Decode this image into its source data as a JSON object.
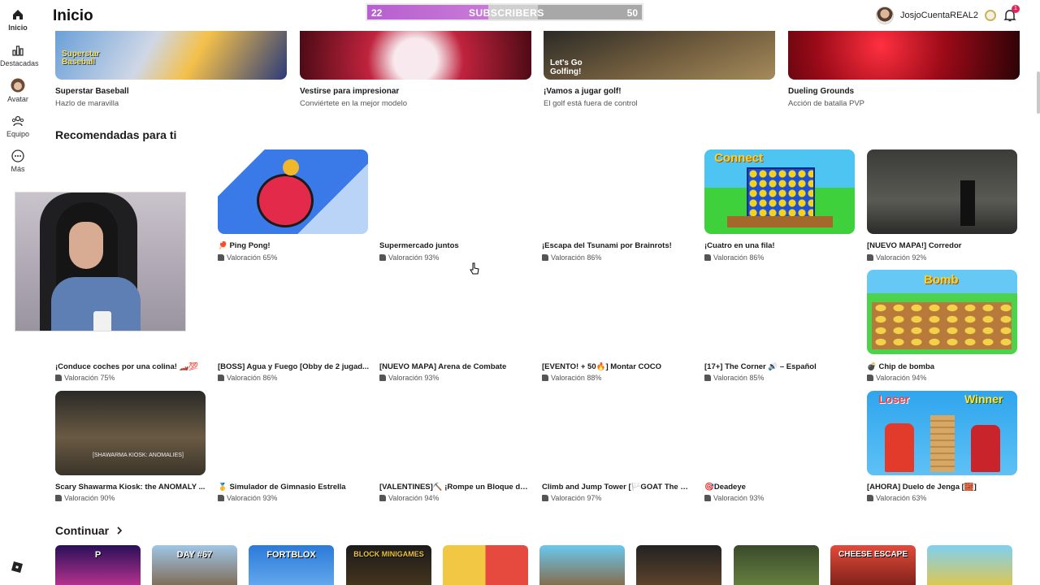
{
  "nav": {
    "items": [
      {
        "label": "Inicio",
        "icon": "home-icon"
      },
      {
        "label": "Destacadas",
        "icon": "chart-icon"
      },
      {
        "label": "Avatar",
        "icon": "avatar-icon"
      },
      {
        "label": "Equipo",
        "icon": "team-icon"
      },
      {
        "label": "Más",
        "icon": "more-icon"
      }
    ],
    "logo_icon": "roblox-logo-icon"
  },
  "header": {
    "title": "Inicio",
    "subscribers": {
      "current": "22",
      "label": "SUBSCRIBERS",
      "goal": "50",
      "progress": 0.44
    },
    "username": "JosjoCuentaREAL2",
    "notification_count": "1"
  },
  "top_strip": [
    {
      "name": "Superstar Baseball",
      "subtitle": "Hazlo de maravilla"
    },
    {
      "name": "Vestirse para impresionar",
      "subtitle": "Conviértete en la mejor modelo"
    },
    {
      "name": "¡Vamos a jugar golf!",
      "subtitle": "El golf está fuera de control"
    },
    {
      "name": "Dueling Grounds",
      "subtitle": "Acción de batalla PVP"
    }
  ],
  "recommended": {
    "title": "Recomendadas para ti",
    "rows": [
      [
        {
          "name": "🏓 Ping Pong!",
          "rating": "Valoración 65%"
        },
        {
          "name": "Supermercado juntos",
          "rating": "Valoración 93%"
        },
        {
          "name": "¡Escapa del Tsunami por Brainrots!",
          "rating": "Valoración 86%"
        },
        {
          "name": "¡Cuatro en una fila!",
          "rating": "Valoración 86%"
        },
        {
          "name": "[NUEVO MAPA!] Corredor",
          "rating": "Valoración 92%"
        }
      ],
      [
        {
          "name": "¡Conduce coches por una colina! 🏎️💯",
          "rating": "Valoración 75%"
        },
        {
          "name": "[BOSS] Agua y Fuego [Obby de 2 jugad...",
          "rating": "Valoración 86%"
        },
        {
          "name": "[NUEVO MAPA] Arena de Combate",
          "rating": "Valoración 93%"
        },
        {
          "name": "[EVENTO! + 50🔥] Montar COCO",
          "rating": "Valoración 88%"
        },
        {
          "name": "[17+] The Corner 🔊 – Español",
          "rating": "Valoración 85%"
        },
        {
          "name": "💣 Chip de bomba",
          "rating": "Valoración 94%"
        }
      ],
      [
        {
          "name": "Scary Shawarma Kiosk: the ANOMALY ...",
          "rating": "Valoración 90%"
        },
        {
          "name": "🥇 Simulador de Gimnasio Estrella",
          "rating": "Valoración 93%"
        },
        {
          "name": "[VALENTINES]⛏️ ¡Rompe un Bloque de l...",
          "rating": "Valoración 94%"
        },
        {
          "name": "Climb and Jump Tower [🏳️GOAT The M...",
          "rating": "Valoración 97%"
        },
        {
          "name": "🎯Deadeye",
          "rating": "Valoración 93%"
        },
        {
          "name": "[AHORA] Duelo de Jenga [🧱]",
          "rating": "Valoración 63%"
        }
      ]
    ],
    "thumb_texts": {
      "connect": "Connect",
      "bomb": "Bomb",
      "loser": "Loser",
      "winner": "Winner",
      "shawarma": "[SHAWARMA KIOSK: ANOMALIES]",
      "baseball_logo": "Superstar Baseball",
      "golf_logo": "Let's Go Golfing!"
    }
  },
  "continue": {
    "title": "Continuar",
    "thumbs": [
      "P",
      "DAY #67",
      "FORTBLOX",
      "BLOCK MINIGAMES",
      "",
      "",
      "",
      "",
      "CHEESE ESCAPE",
      ""
    ]
  }
}
